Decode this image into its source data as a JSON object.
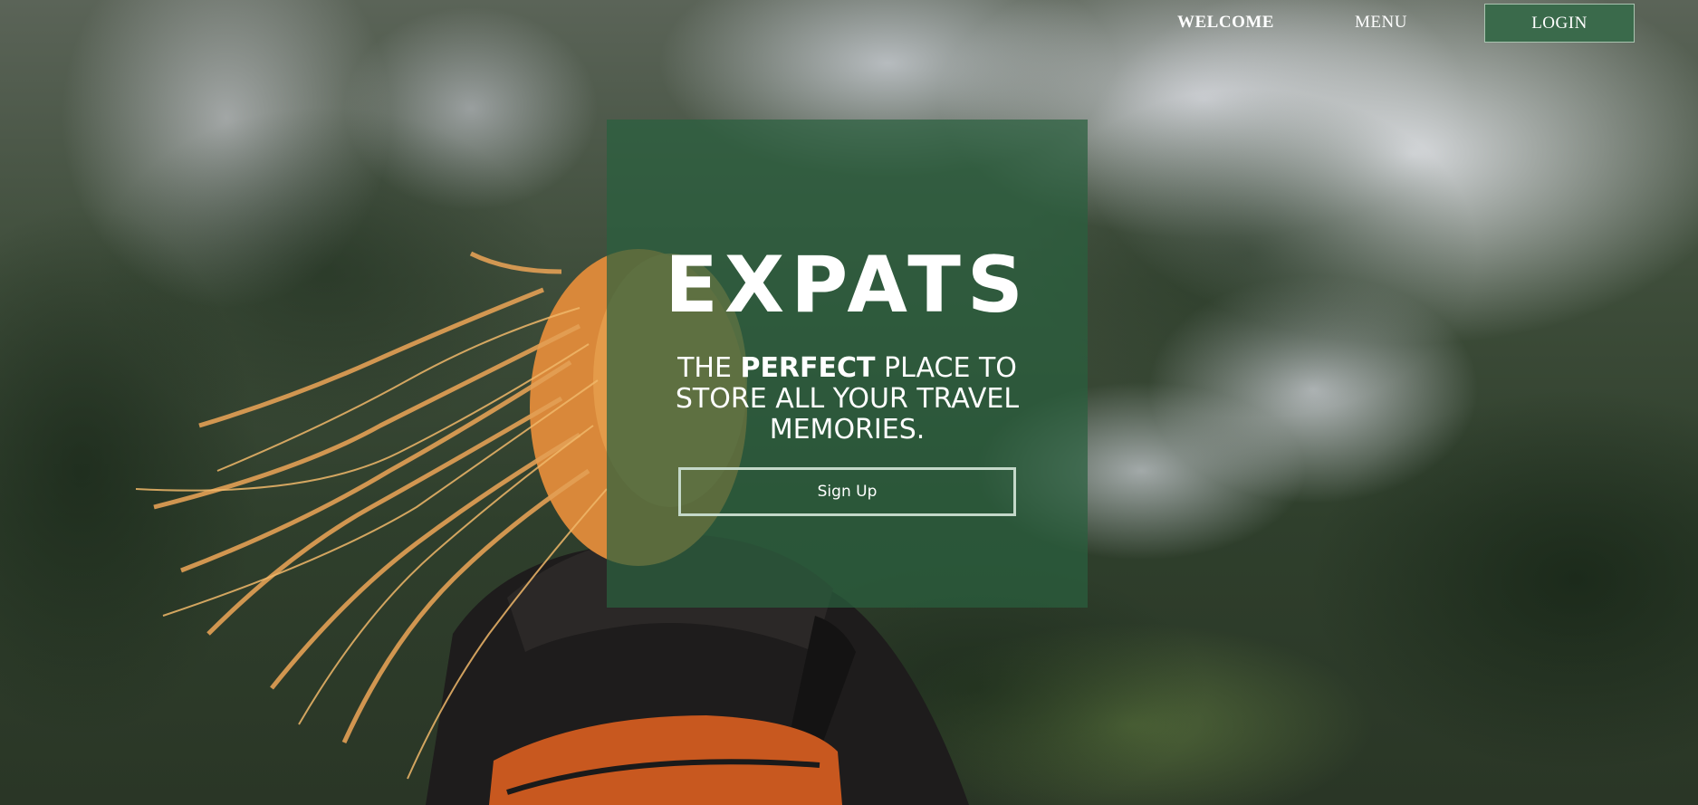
{
  "nav": {
    "welcome_label": "WELCOME",
    "menu_label": "MENU",
    "login_label": "LOGIN"
  },
  "hero": {
    "title": "EXPATS",
    "tagline_before": "THE ",
    "tagline_emphasis": "PERFECT",
    "tagline_after": " PLACE TO STORE ALL YOUR TRAVEL MEMORIES.",
    "signup_label": "Sign Up"
  },
  "colors": {
    "card_background": "#2a603e",
    "login_button": "#3a6a4b",
    "button_border": "#c4d8c9",
    "text": "#ffffff"
  }
}
